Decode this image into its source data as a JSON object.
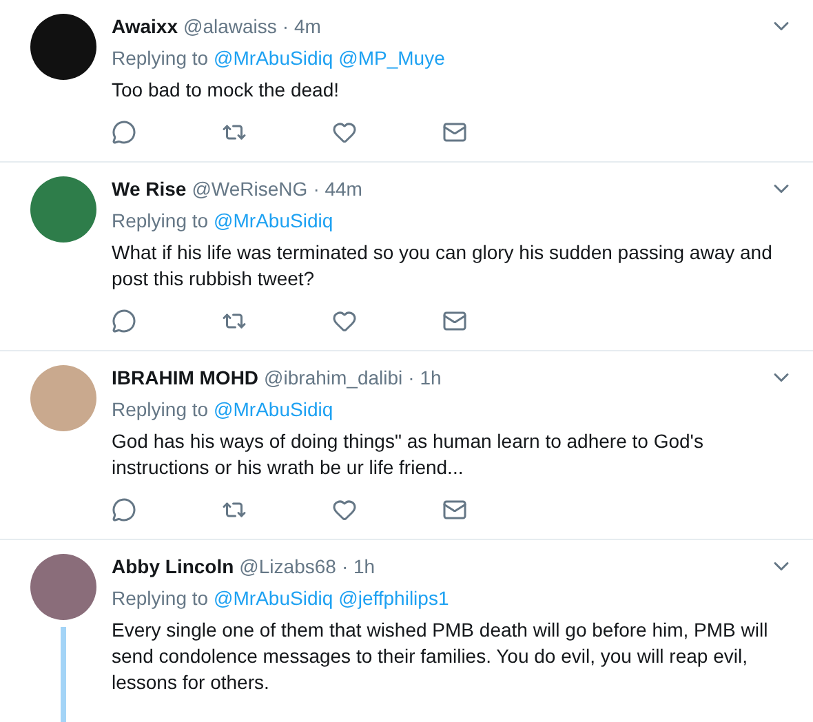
{
  "tweets": [
    {
      "name": "Awaixx",
      "handle": "@alawaiss",
      "time": "· 4m",
      "replying_label": "Replying to",
      "mentions": [
        "@MrAbuSidiq",
        "@MP_Muye"
      ],
      "text": "Too bad to mock the dead!",
      "actions_visible": true,
      "thread_line": false
    },
    {
      "name": "We Rise",
      "handle": "@WeRiseNG",
      "time": "· 44m",
      "replying_label": "Replying to",
      "mentions": [
        "@MrAbuSidiq"
      ],
      "text": "What if his life was terminated so you can glory his sudden passing away and post this rubbish tweet?",
      "actions_visible": true,
      "thread_line": false
    },
    {
      "name": "IBRAHIM MOHD",
      "handle": "@ibrahim_dalibi",
      "time": "· 1h",
      "replying_label": "Replying to",
      "mentions": [
        "@MrAbuSidiq"
      ],
      "text": "God has his ways of doing things\" as human learn to adhere to God's instructions or his wrath be ur life friend...",
      "actions_visible": true,
      "thread_line": false
    },
    {
      "name": "Abby Lincoln",
      "handle": "@Lizabs68",
      "time": "· 1h",
      "replying_label": "Replying to",
      "mentions": [
        "@MrAbuSidiq",
        "@jeffphilips1"
      ],
      "text": "Every single one of them that wished PMB death will go before him, PMB will send condolence messages to their families. You do evil, you will reap evil, lessons for others.",
      "actions_visible": false,
      "thread_line": true
    }
  ]
}
